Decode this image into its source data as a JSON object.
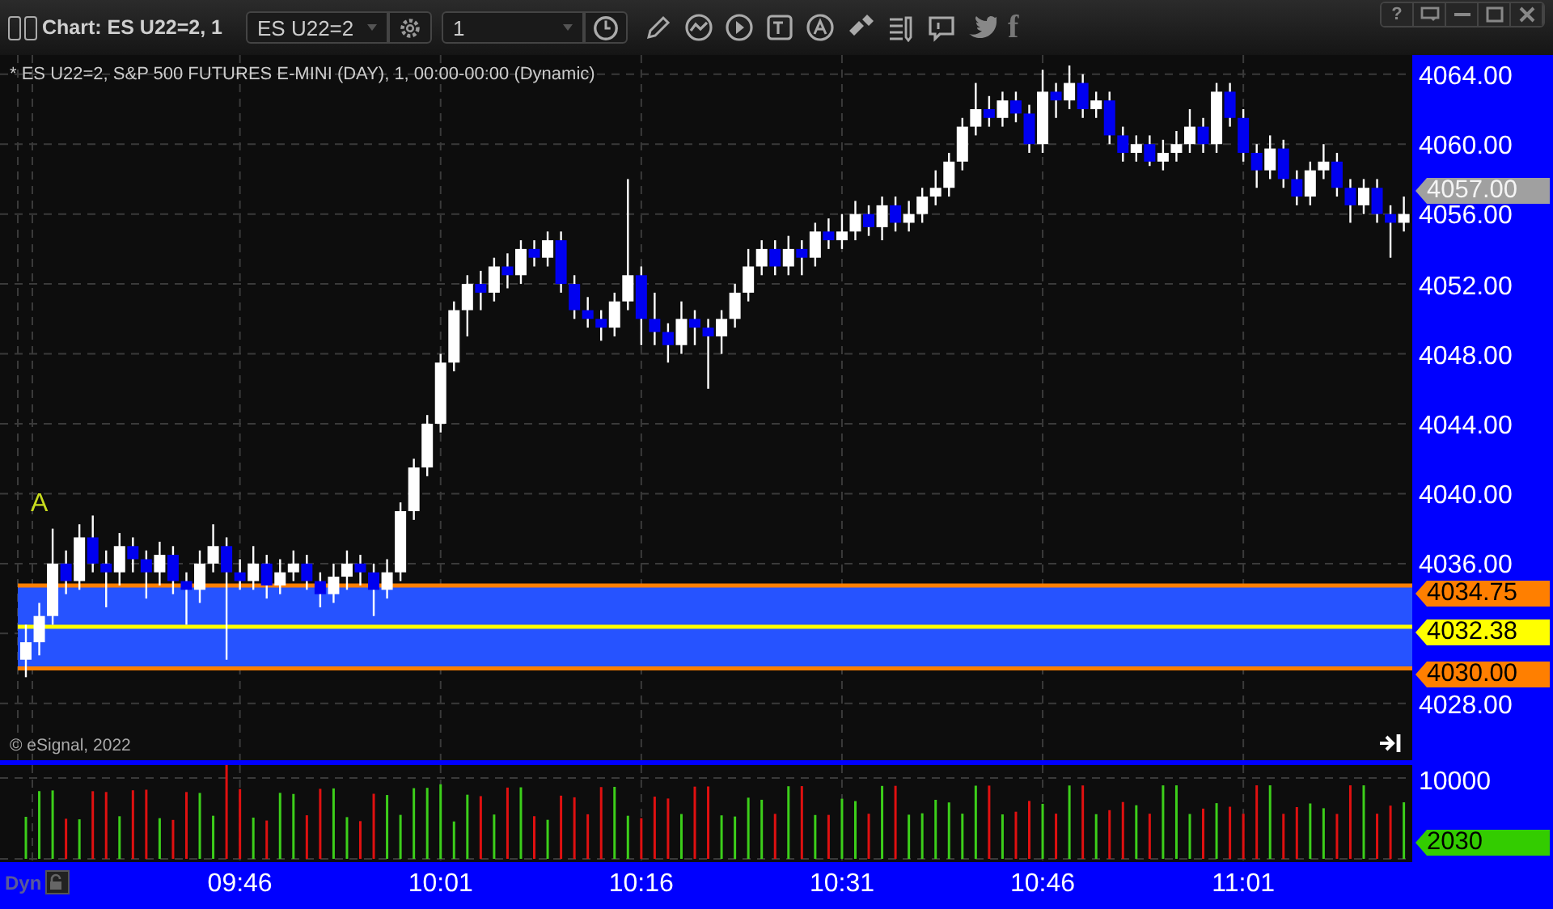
{
  "window": {
    "title": "Chart: ES U22=2, 1",
    "help_button": "?"
  },
  "toolbar": {
    "symbol": "ES U22=2",
    "interval": "1",
    "facebook_glyph": "f"
  },
  "chart": {
    "legend": "* ES U22=2, S&P 500 FUTURES E-MINI (DAY), 1, 00:00-00:00 (Dynamic)",
    "marker": "A",
    "copyright": "© eSignal, 2022",
    "chart_data": {
      "type": "candlestick",
      "categories": [
        null,
        null,
        null,
        null,
        null,
        null,
        null,
        null,
        null,
        null,
        null,
        null,
        null,
        null,
        null,
        null,
        "09:46",
        null,
        null,
        null,
        null,
        null,
        null,
        null,
        null,
        null,
        null,
        null,
        null,
        null,
        null,
        "10:01",
        null,
        null,
        null,
        null,
        null,
        null,
        null,
        null,
        null,
        null,
        null,
        null,
        null,
        null,
        "10:16",
        null,
        null,
        null,
        null,
        null,
        null,
        null,
        null,
        null,
        null,
        null,
        null,
        null,
        null,
        "10:31",
        null,
        null,
        null,
        null,
        null,
        null,
        null,
        null,
        null,
        null,
        null,
        null,
        null,
        null,
        "10:46",
        null,
        null,
        null,
        null,
        null,
        null,
        null,
        null,
        null,
        null,
        null,
        null,
        null,
        null,
        "11:01",
        null,
        null,
        null,
        null,
        null,
        null,
        null,
        null,
        null,
        null,
        null,
        null
      ],
      "ylim": [
        4024.75,
        4065.1
      ],
      "grid": true,
      "bands": [
        {
          "axis": "y",
          "from": 4030,
          "to": 4034.75,
          "color": "#2653ff"
        }
      ],
      "ref_lines": [
        {
          "axis": "y",
          "value": 4034.75,
          "color": "#ff7f00"
        },
        {
          "axis": "y",
          "value": 4032.38,
          "color": "#ffff00"
        },
        {
          "axis": "y",
          "value": 4030,
          "color": "#ff7f00"
        }
      ],
      "ohlc": [
        [
          4030.5,
          4032.5,
          4029.5,
          4031.5
        ],
        [
          4031.5,
          4033.75,
          4030.75,
          4033
        ],
        [
          4033,
          4038,
          4032.5,
          4036
        ],
        [
          4036,
          4036.75,
          4034.25,
          4035
        ],
        [
          4035,
          4038.25,
          4034.5,
          4037.5
        ],
        [
          4037.5,
          4038.75,
          4035.5,
          4036
        ],
        [
          4036,
          4036.75,
          4033.5,
          4035.5
        ],
        [
          4035.5,
          4037.75,
          4034.75,
          4037
        ],
        [
          4037,
          4037.5,
          4035.5,
          4036.25
        ],
        [
          4036.25,
          4036.75,
          4034,
          4035.5
        ],
        [
          4035.5,
          4037.25,
          4034.75,
          4036.5
        ],
        [
          4036.5,
          4037,
          4034.25,
          4035
        ],
        [
          4035,
          4035.5,
          4032.5,
          4034.5
        ],
        [
          4034.5,
          4036.75,
          4033.75,
          4036
        ],
        [
          4036,
          4038.25,
          4035.5,
          4037
        ],
        [
          4037,
          4037.5,
          4030.5,
          4035.5
        ],
        [
          4035.5,
          4036.25,
          4034.5,
          4035
        ],
        [
          4035,
          4037,
          4034.5,
          4036
        ],
        [
          4036,
          4036.5,
          4034,
          4034.75
        ],
        [
          4034.75,
          4036.25,
          4034.25,
          4035.5
        ],
        [
          4035.5,
          4036.75,
          4035,
          4036
        ],
        [
          4036,
          4036.5,
          4034.5,
          4035
        ],
        [
          4035,
          4035.5,
          4033.5,
          4034.25
        ],
        [
          4034.25,
          4036,
          4033.75,
          4035.25
        ],
        [
          4035.25,
          4036.75,
          4034.5,
          4036
        ],
        [
          4036,
          4036.5,
          4034.75,
          4035.5
        ],
        [
          4035.5,
          4036,
          4033,
          4034.5
        ],
        [
          4034.5,
          4036.25,
          4034,
          4035.5
        ],
        [
          4035.5,
          4039.5,
          4035,
          4039
        ],
        [
          4039,
          4042,
          4038.5,
          4041.5
        ],
        [
          4041.5,
          4044.5,
          4041,
          4044
        ],
        [
          4044,
          4048,
          4043.5,
          4047.5
        ],
        [
          4047.5,
          4051,
          4047,
          4050.5
        ],
        [
          4050.5,
          4052.5,
          4049,
          4052
        ],
        [
          4052,
          4052.75,
          4050.5,
          4051.5
        ],
        [
          4051.5,
          4053.5,
          4051,
          4053
        ],
        [
          4053,
          4053.75,
          4051.75,
          4052.5
        ],
        [
          4052.5,
          4054.5,
          4052,
          4054
        ],
        [
          4054,
          4054.5,
          4053,
          4053.5
        ],
        [
          4053.5,
          4055,
          4053,
          4054.5
        ],
        [
          4054.5,
          4055,
          4051.5,
          4052
        ],
        [
          4052,
          4052.5,
          4050,
          4050.5
        ],
        [
          4050.5,
          4051.25,
          4049.5,
          4050
        ],
        [
          4050,
          4050.5,
          4048.75,
          4049.5
        ],
        [
          4049.5,
          4051.5,
          4049,
          4051
        ],
        [
          4051,
          4058,
          4050.5,
          4052.5
        ],
        [
          4052.5,
          4053,
          4048.5,
          4050
        ],
        [
          4050,
          4051.5,
          4048.5,
          4049.25
        ],
        [
          4049.25,
          4049.75,
          4047.5,
          4048.5
        ],
        [
          4048.5,
          4051,
          4048,
          4050
        ],
        [
          4050,
          4050.5,
          4048.5,
          4049.5
        ],
        [
          4049.5,
          4050,
          4046,
          4049
        ],
        [
          4049,
          4050.5,
          4048,
          4050
        ],
        [
          4050,
          4052,
          4049.5,
          4051.5
        ],
        [
          4051.5,
          4054,
          4051,
          4053
        ],
        [
          4053,
          4054.5,
          4052.5,
          4054
        ],
        [
          4054,
          4054.5,
          4052.5,
          4053
        ],
        [
          4053,
          4054.75,
          4052.5,
          4054
        ],
        [
          4054,
          4054.5,
          4052.5,
          4053.5
        ],
        [
          4053.5,
          4055.5,
          4053,
          4055
        ],
        [
          4055,
          4055.75,
          4054,
          4054.5
        ],
        [
          4054.5,
          4056,
          4054,
          4055
        ],
        [
          4055,
          4056.75,
          4054.5,
          4056
        ],
        [
          4056,
          4056.5,
          4054.75,
          4055.25
        ],
        [
          4055.25,
          4057,
          4054.5,
          4056.5
        ],
        [
          4056.5,
          4057,
          4055,
          4055.5
        ],
        [
          4055.5,
          4056.75,
          4055,
          4056
        ],
        [
          4056,
          4057.5,
          4055.5,
          4057
        ],
        [
          4057,
          4058.5,
          4056.5,
          4057.5
        ],
        [
          4057.5,
          4059.5,
          4057,
          4059
        ],
        [
          4059,
          4061.5,
          4058.5,
          4061
        ],
        [
          4061,
          4063.5,
          4060.5,
          4062
        ],
        [
          4062,
          4062.75,
          4061,
          4061.5
        ],
        [
          4061.5,
          4063,
          4061,
          4062.5
        ],
        [
          4062.5,
          4063,
          4061.25,
          4061.75
        ],
        [
          4061.75,
          4062.25,
          4059.5,
          4060
        ],
        [
          4060,
          4064.25,
          4059.5,
          4063
        ],
        [
          4063,
          4063.5,
          4061.5,
          4062.5
        ],
        [
          4062.5,
          4064.5,
          4062,
          4063.5
        ],
        [
          4063.5,
          4064,
          4061.5,
          4062
        ],
        [
          4062,
          4063,
          4061.5,
          4062.5
        ],
        [
          4062.5,
          4063,
          4060,
          4060.5
        ],
        [
          4060.5,
          4061,
          4059,
          4059.5
        ],
        [
          4059.5,
          4060.5,
          4059,
          4060
        ],
        [
          4060,
          4060.5,
          4058.75,
          4059
        ],
        [
          4059,
          4060.25,
          4058.5,
          4059.5
        ],
        [
          4059.5,
          4060.75,
          4059,
          4060
        ],
        [
          4060,
          4062,
          4059.5,
          4061
        ],
        [
          4061,
          4061.5,
          4059.5,
          4060
        ],
        [
          4060,
          4063.5,
          4059.5,
          4063
        ],
        [
          4063,
          4063.5,
          4061,
          4061.5
        ],
        [
          4061.5,
          4062,
          4059,
          4059.5
        ],
        [
          4059.5,
          4060,
          4057.5,
          4058.5
        ],
        [
          4058.5,
          4060.5,
          4058,
          4059.75
        ],
        [
          4059.75,
          4060.25,
          4057.5,
          4058
        ],
        [
          4058,
          4058.5,
          4056.5,
          4057
        ],
        [
          4057,
          4059,
          4056.5,
          4058.5
        ],
        [
          4058.5,
          4060,
          4058,
          4059
        ],
        [
          4059,
          4059.5,
          4057,
          4057.5
        ],
        [
          4057.5,
          4058,
          4055.5,
          4056.5
        ],
        [
          4056.5,
          4058,
          4056,
          4057.5
        ],
        [
          4057.5,
          4058,
          4055.5,
          4056
        ],
        [
          4056,
          4056.5,
          4053.5,
          4055.5
        ],
        [
          4055.5,
          4057,
          4055,
          4056
        ]
      ],
      "yticks": [
        {
          "value": 4064,
          "label": "4064.00"
        },
        {
          "value": 4060,
          "label": "4060.00"
        },
        {
          "value": 4056,
          "label": "4056.00"
        },
        {
          "value": 4052,
          "label": "4052.00"
        },
        {
          "value": 4048,
          "label": "4048.00"
        },
        {
          "value": 4044,
          "label": "4044.00"
        },
        {
          "value": 4040,
          "label": "4040.00"
        },
        {
          "value": 4036,
          "label": "4036.00"
        },
        {
          "value": 4028,
          "label": "4028.00"
        }
      ]
    }
  },
  "price_axis": {
    "tags": [
      {
        "label": "4057.00",
        "color": "#a0a0a0"
      },
      {
        "label": "4034.75",
        "color": "#ff7f00"
      },
      {
        "label": "4032.38",
        "color": "#ffff00"
      },
      {
        "label": "4030.00",
        "color": "#ff7f00"
      }
    ]
  },
  "volume_axis": {
    "ticks": [
      "10000"
    ],
    "tags": [
      {
        "label": "2030",
        "color": "#33cc00"
      }
    ]
  },
  "time_axis": {
    "mode": "Dyn"
  }
}
